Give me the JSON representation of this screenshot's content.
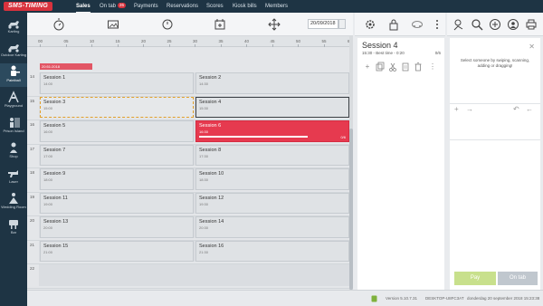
{
  "app": {
    "logo": "SMS-TIMING"
  },
  "nav": [
    {
      "label": "Sales",
      "active": true
    },
    {
      "label": "On tab",
      "badge": "26"
    },
    {
      "label": "Payments"
    },
    {
      "label": "Reservations"
    },
    {
      "label": "Scores"
    },
    {
      "label": "Kiosk bills"
    },
    {
      "label": "Members"
    }
  ],
  "rail": [
    {
      "label": "Karting",
      "icon": "kart-icon"
    },
    {
      "label": "Outdoor Karting",
      "icon": "kart-icon"
    },
    {
      "label": "Paintball",
      "icon": "paintball-icon",
      "active": true
    },
    {
      "label": "Playground",
      "icon": "playground-icon"
    },
    {
      "label": "Prison Island",
      "icon": "prison-icon"
    },
    {
      "label": "Shop",
      "icon": "shop-icon"
    },
    {
      "label": "Laser",
      "icon": "laser-icon"
    },
    {
      "label": "Wedding Room",
      "icon": "wedding-icon"
    },
    {
      "label": "Bar",
      "icon": "bar-icon"
    }
  ],
  "toolbar": {
    "date": "20/09/2018"
  },
  "timeline": {
    "ticks": [
      "00",
      "05",
      "10",
      "15",
      "20",
      "25",
      "30",
      "35",
      "40",
      "45",
      "50",
      "55",
      "60"
    ]
  },
  "heat_label": "20:51:2018",
  "hours": [
    "14",
    "15",
    "16",
    "17",
    "18",
    "19",
    "20",
    "21",
    "22"
  ],
  "sessions": [
    {
      "name": "Session 1",
      "time": "14:00"
    },
    {
      "name": "Session 2",
      "time": "14:30"
    },
    {
      "name": "Session 3",
      "time": "15:00"
    },
    {
      "name": "Session 4",
      "time": "15:30"
    },
    {
      "name": "Session 5",
      "time": "16:00"
    },
    {
      "name": "Session 6",
      "time": "16:30",
      "count": "0/6"
    },
    {
      "name": "Session 7",
      "time": "17:00"
    },
    {
      "name": "Session 8",
      "time": "17:30"
    },
    {
      "name": "Session 9",
      "time": "18:00"
    },
    {
      "name": "Session 10",
      "time": "18:30"
    },
    {
      "name": "Session 11",
      "time": "19:00"
    },
    {
      "name": "Session 12",
      "time": "19:30"
    },
    {
      "name": "Session 13",
      "time": "20:00"
    },
    {
      "name": "Session 14",
      "time": "20:30"
    },
    {
      "name": "Session 15",
      "time": "21:00"
    },
    {
      "name": "Session 16",
      "time": "21:30"
    }
  ],
  "session_panel": {
    "title": "Session 4",
    "subtitle": "15:30 - Best time - 0:20",
    "count": "0/6"
  },
  "right_panel": {
    "hint": "Select someone by swiping, scanning, adding or dragging!",
    "pay_label": "Pay",
    "tab_label": "On tab"
  },
  "status": {
    "version": "Version 5.10.7.31",
    "machine": "DESKTOP-U8FC3AT",
    "datetime": "donderdag 20 september 2018 15:23:38"
  },
  "colors": {
    "topbar": "#1e3444",
    "accent_red": "#e63a4f",
    "pay_green": "#c8e08c"
  }
}
